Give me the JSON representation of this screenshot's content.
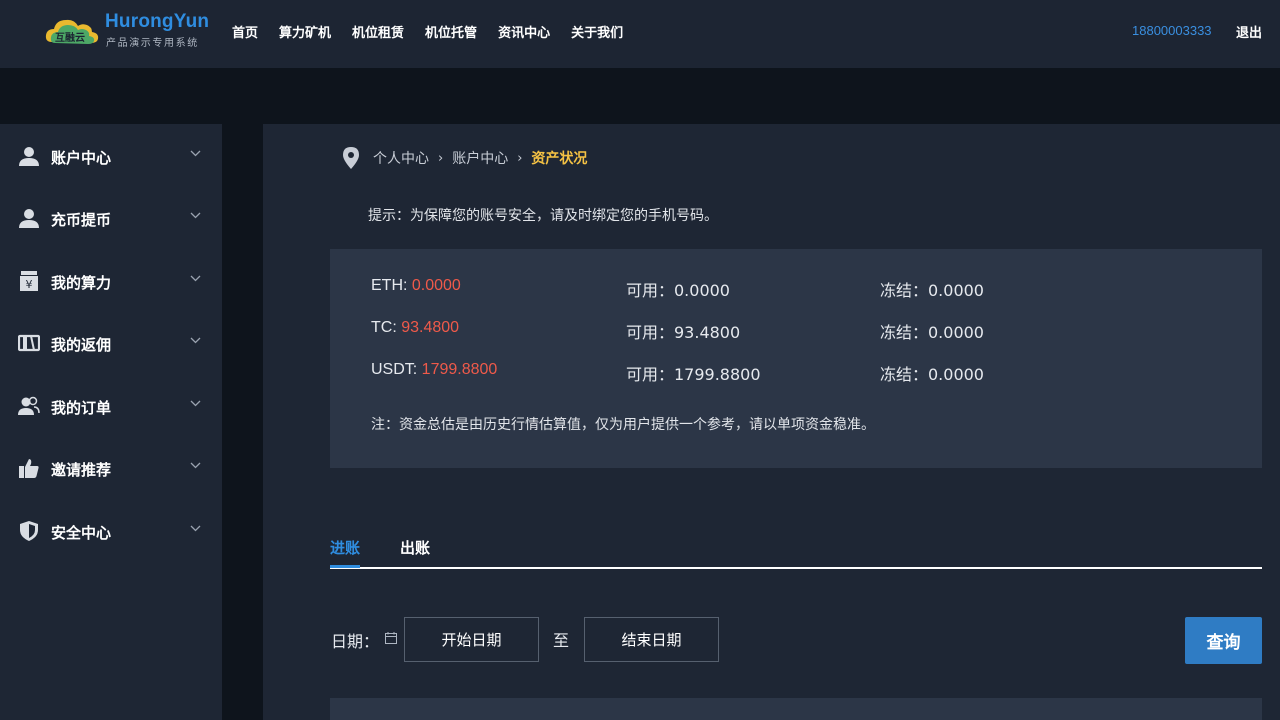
{
  "brand": {
    "title": "HurongYun",
    "subtitle": "产品演示专用系统",
    "logo_text": "互融云"
  },
  "nav": {
    "items": [
      "首页",
      "算力矿机",
      "机位租赁",
      "机位托管",
      "资讯中心",
      "关于我们"
    ]
  },
  "user": {
    "phone": "18800003333",
    "logout_label": "退出"
  },
  "sidebar": {
    "items": [
      {
        "label": "账户中心",
        "icon": "user-icon"
      },
      {
        "label": "充币提币",
        "icon": "user-icon"
      },
      {
        "label": "我的算力",
        "icon": "yuan-box-icon"
      },
      {
        "label": "我的返佣",
        "icon": "card-icon"
      },
      {
        "label": "我的订单",
        "icon": "users-icon"
      },
      {
        "label": "邀请推荐",
        "icon": "thumbs-up-icon"
      },
      {
        "label": "安全中心",
        "icon": "shield-icon"
      }
    ]
  },
  "breadcrumb": {
    "items": [
      "个人中心",
      "账户中心",
      "资产状况"
    ]
  },
  "tip": "提示：为保障您的账号安全，请及时绑定您的手机号码。",
  "balances": {
    "rows": [
      {
        "asset": "ETH: ",
        "total": "0.0000",
        "available": "可用：0.0000",
        "frozen": "冻结：0.0000"
      },
      {
        "asset": "TC: ",
        "total": "93.4800",
        "available": "可用：93.4800",
        "frozen": "冻结：0.0000"
      },
      {
        "asset": "USDT: ",
        "total": "1799.8800",
        "available": "可用：1799.8800",
        "frozen": "冻结：0.0000"
      }
    ],
    "note": "注：资金总估是由历史行情估算值，仅为用户提供一个参考，请以单项资金稳准。"
  },
  "tabs": {
    "items": [
      "进账",
      "出账"
    ],
    "active": "进账"
  },
  "filter": {
    "date_label": "日期：",
    "start_placeholder": "开始日期",
    "to_label": "至",
    "end_placeholder": "结束日期",
    "query_label": "查询"
  },
  "colors": {
    "accent": "#2f8de0",
    "highlight": "#f5c244",
    "value_red": "#ef5a4a",
    "panel": "#1e2634",
    "box": "#2c3647"
  }
}
